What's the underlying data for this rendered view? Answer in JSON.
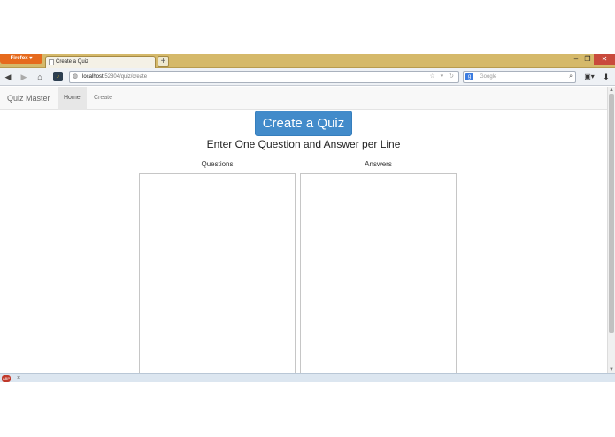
{
  "browser": {
    "menu_button_label": "Firefox",
    "tab_title": "Create a Quiz",
    "new_tab_label": "+",
    "url_host": "localhost",
    "url_path": ":52804/quiz/create",
    "search_placeholder": "Google",
    "window_min": "–",
    "window_max": "❐",
    "window_close": "✕",
    "back_glyph": "◀",
    "forward_glyph": "▶",
    "home_glyph": "⌂",
    "url_icons": "☆ ▾ ↻",
    "search_glyph": "⌕",
    "search_engine_glyph": "g",
    "bookmark_glyph": "▣▾",
    "download_glyph": "⬇",
    "addon_close": "×",
    "abp_label": "ABP"
  },
  "site": {
    "brand": "Quiz Master",
    "nav": [
      {
        "label": "Home",
        "active": true
      },
      {
        "label": "Create",
        "active": false
      }
    ]
  },
  "main": {
    "create_button_label": "Create a Quiz",
    "instructions": "Enter One Question and Answer per Line",
    "questions_label": "Questions",
    "answers_label": "Answers",
    "questions_value": "",
    "answers_value": ""
  },
  "colors": {
    "primary_button": "#428bca",
    "firefox_orange": "#e66a1d",
    "tabbar": "#d5b96a"
  }
}
